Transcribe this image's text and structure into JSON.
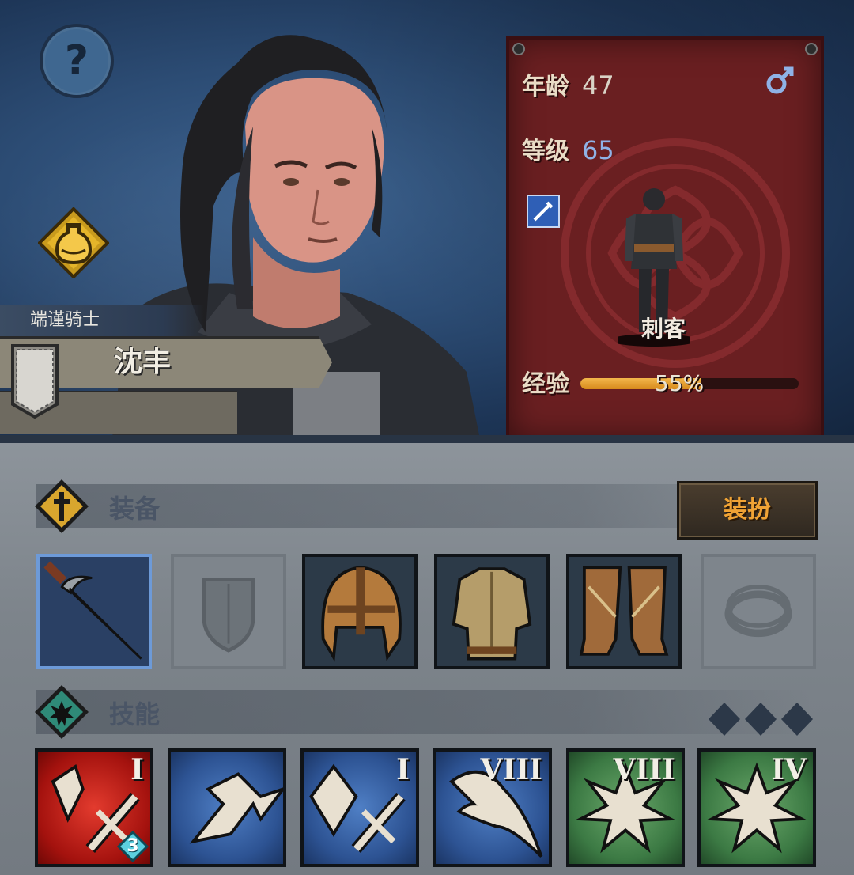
{
  "header": {
    "help_label": "?",
    "title_tag": "端谨骑士",
    "character_name": "沈丰"
  },
  "info": {
    "age_label": "年龄",
    "age_value": "47",
    "level_label": "等级",
    "level_value": "65",
    "class_name": "刺客",
    "xp_label": "经验",
    "xp_percent_text": "55%",
    "xp_fraction": 0.55,
    "gender_icon": "male-icon",
    "class_icon": "dagger-class-icon"
  },
  "equipment": {
    "section_label": "装备",
    "dress_button": "装扮",
    "slots": [
      {
        "icon": "dagger-icon",
        "state": "selected"
      },
      {
        "icon": "shield-icon",
        "state": "empty"
      },
      {
        "icon": "helmet-icon",
        "state": "filled"
      },
      {
        "icon": "armor-icon",
        "state": "filled"
      },
      {
        "icon": "boots-icon",
        "state": "filled"
      },
      {
        "icon": "ring-icon",
        "state": "empty"
      }
    ]
  },
  "skills": {
    "section_label": "技能",
    "items": [
      {
        "icon": "broken-sword-icon",
        "color": "red",
        "rank": "I",
        "badge": "3"
      },
      {
        "icon": "dash-strike-icon",
        "color": "blue",
        "rank": "",
        "badge": ""
      },
      {
        "icon": "crystal-sword-icon",
        "color": "blue",
        "rank": "I",
        "badge": ""
      },
      {
        "icon": "claw-slash-icon",
        "color": "blue",
        "rank": "VIII",
        "badge": ""
      },
      {
        "icon": "burst-icon",
        "color": "green",
        "rank": "VIII",
        "badge": ""
      },
      {
        "icon": "burst-icon",
        "color": "green",
        "rank": "IV",
        "badge": ""
      }
    ]
  },
  "colors": {
    "accent_orange": "#f0a335",
    "panel_red": "#6a1f21",
    "level_blue": "#8fb2e6"
  }
}
